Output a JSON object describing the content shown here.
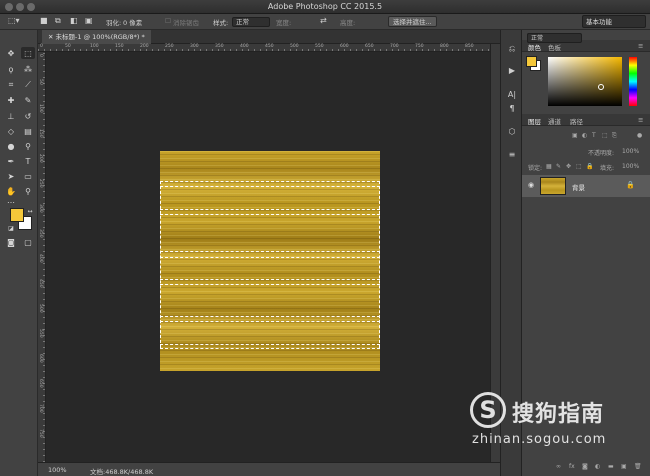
{
  "window": {
    "title": "Adobe Photoshop CC 2015.5"
  },
  "options_bar": {
    "feather_label": "羽化:",
    "feather_value": "0 像素",
    "antialias_label": "消除锯齿",
    "style_label": "样式:",
    "style_value": "正常",
    "width_label": "宽度:",
    "height_label": "高度:",
    "select_mask_button": "选择并遮住...",
    "workspace_value": "基本功能"
  },
  "document": {
    "tab_label": "未标题-1 @ 100%(RGB/8*) *",
    "zoom": "100%",
    "doc_size": "文档:468.8K/468.8K"
  },
  "ruler": {
    "h_ticks": [
      "0",
      "50",
      "100",
      "150",
      "200",
      "250",
      "300",
      "350",
      "400",
      "450",
      "500",
      "550",
      "600",
      "650",
      "700",
      "750",
      "800",
      "850"
    ],
    "v_ticks": [
      "0",
      "50",
      "100",
      "150",
      "200",
      "250",
      "300",
      "350",
      "400",
      "450",
      "500",
      "550",
      "600",
      "650",
      "700",
      "750"
    ]
  },
  "color_panel": {
    "tab_color": "颜色",
    "tab_swatches": "色板",
    "foreground": "#f5c83a",
    "background": "#ffffff"
  },
  "layers_panel": {
    "tab_layers": "图层",
    "tab_channels": "通道",
    "tab_paths": "路径",
    "kind_label": "类型",
    "blend_mode": "正常",
    "opacity_label": "不透明度:",
    "opacity_value": "100%",
    "lock_label": "锁定:",
    "fill_label": "填充:",
    "fill_value": "100%",
    "layers": [
      {
        "name": "背景",
        "visible": true,
        "locked": true
      }
    ]
  },
  "watermark": {
    "brand": "搜狗指南",
    "url": "zhinan.sogou.com"
  }
}
